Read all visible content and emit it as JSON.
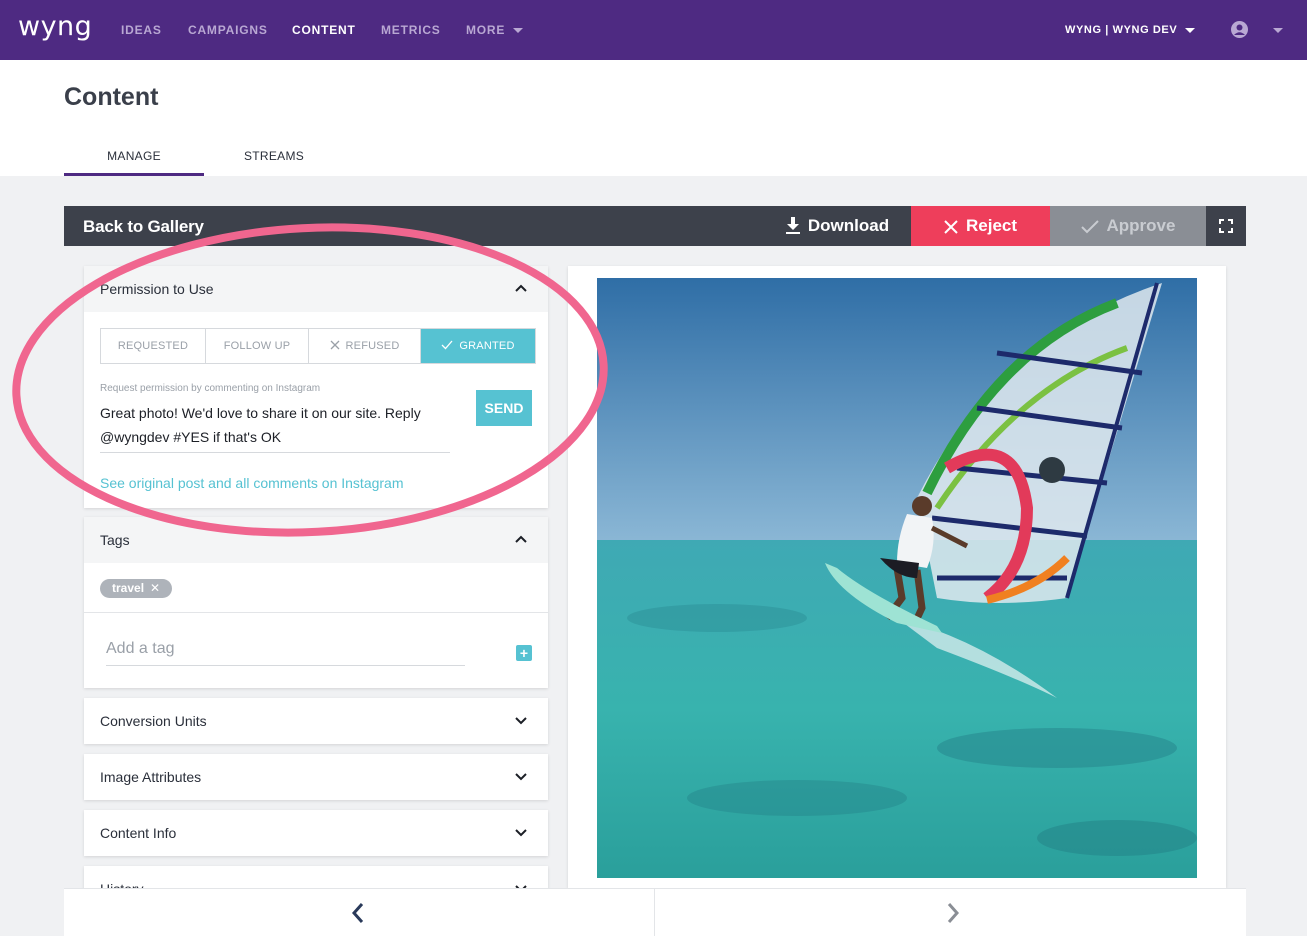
{
  "nav": {
    "logo": "wyng",
    "items": [
      "IDEAS",
      "CAMPAIGNS",
      "CONTENT",
      "METRICS",
      "MORE"
    ],
    "account": "WYNG | WYNG DEV"
  },
  "page": {
    "title": "Content",
    "tabs": [
      "MANAGE",
      "STREAMS"
    ]
  },
  "toolbar": {
    "back": "Back to Gallery",
    "download": "Download",
    "reject": "Reject",
    "approve": "Approve"
  },
  "permission": {
    "title": "Permission to Use",
    "states": [
      "REQUESTED",
      "FOLLOW UP",
      "REFUSED",
      "GRANTED"
    ],
    "active_state": "GRANTED",
    "request_label": "Request permission by commenting on Instagram",
    "request_text": "Great photo! We'd love to share it on our site. Reply @wyngdev #YES if that's OK",
    "send": "SEND",
    "original_link": "See original post and all comments on Instagram"
  },
  "tags": {
    "title": "Tags",
    "items": [
      "travel"
    ],
    "add_placeholder": "Add a tag"
  },
  "sections": [
    "Conversion Units",
    "Image Attributes",
    "Content Info",
    "History"
  ],
  "colors": {
    "nav": "#4e2a82",
    "accent": "#56c2d2",
    "reject": "#ee3e5b",
    "approve": "#8a8e95",
    "annotation": "#f0668f"
  }
}
